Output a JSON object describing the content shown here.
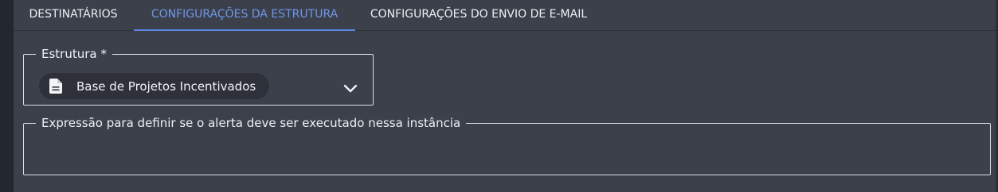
{
  "tabs": [
    {
      "label": "DESTINATÁRIOS",
      "active": false
    },
    {
      "label": "CONFIGURAÇÕES DA ESTRUTURA",
      "active": true
    },
    {
      "label": "CONFIGURAÇÕES DO ENVIO DE E-MAIL",
      "active": false
    }
  ],
  "structure_field": {
    "label": "Estrutura *",
    "selected_value": "Base de Projetos Incentivados",
    "icon": "document-icon",
    "dropdown_icon": "chevron-down-icon"
  },
  "expression_field": {
    "label": "Expressão para definir se o alerta deve ser executado nessa instância",
    "value": ""
  },
  "colors": {
    "background": "#3c404b",
    "active_tab": "#6e96e8",
    "chip_background": "#2e313a",
    "border": "#dadde3"
  }
}
